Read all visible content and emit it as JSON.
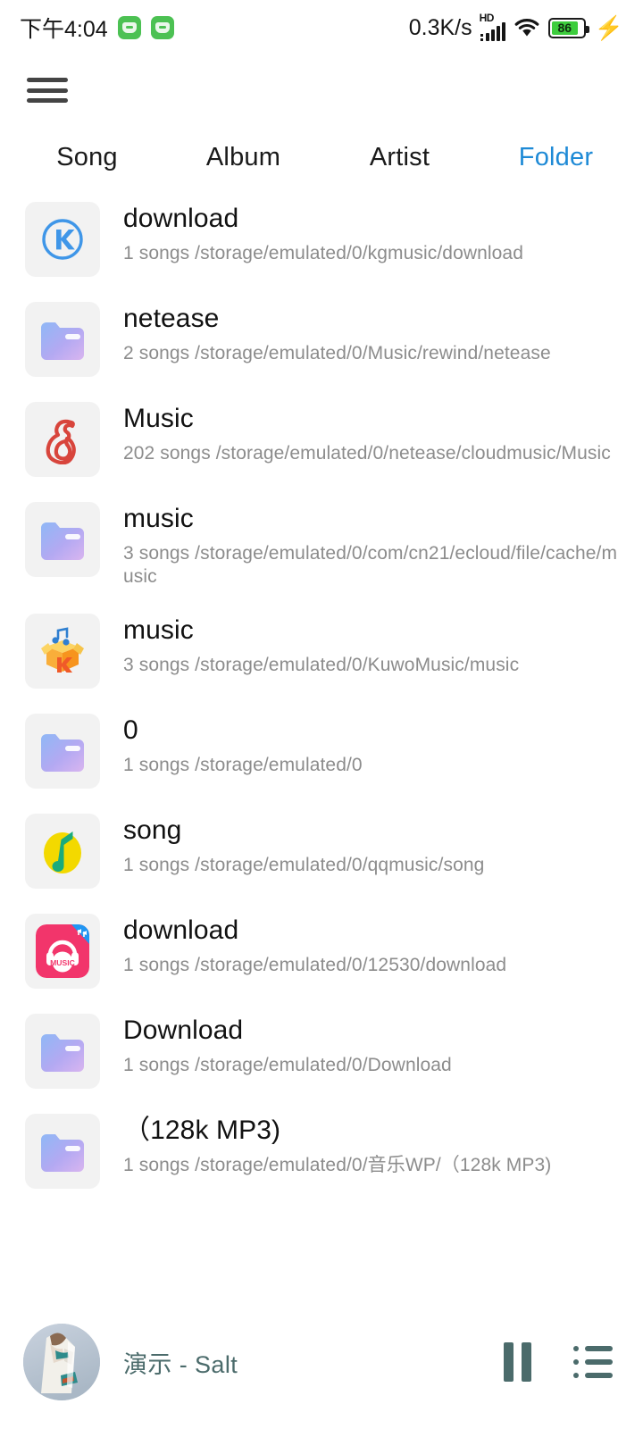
{
  "statusbar": {
    "time": "下午4:04",
    "network_speed": "0.3K/s",
    "hd_label": "HD",
    "battery_percent": "86",
    "icons": [
      "app-notification-icon",
      "app-notification-icon",
      "hd-icon",
      "signal-icon",
      "wifi-icon",
      "battery-icon",
      "charging-bolt-icon"
    ]
  },
  "topbar": {
    "menu_icon": "hamburger-menu-icon"
  },
  "tabs": [
    {
      "label": "Song",
      "active": false
    },
    {
      "label": "Album",
      "active": false
    },
    {
      "label": "Artist",
      "active": false
    },
    {
      "label": "Folder",
      "active": true
    }
  ],
  "accent_color": "#1e8ad6",
  "folders": [
    {
      "title": "download",
      "subtitle": "1 songs /storage/emulated/0/kgmusic/download",
      "icon": "kugou-icon"
    },
    {
      "title": "netease",
      "subtitle": "2 songs /storage/emulated/0/Music/rewind/netease",
      "icon": "folder-icon"
    },
    {
      "title": "Music",
      "subtitle": "202 songs /storage/emulated/0/netease/cloudmusic/Music",
      "icon": "netease-icon"
    },
    {
      "title": "music",
      "subtitle": "3 songs /storage/emulated/0/com/cn21/ecloud/file/cache/music",
      "icon": "folder-icon"
    },
    {
      "title": "music",
      "subtitle": "3 songs /storage/emulated/0/KuwoMusic/music",
      "icon": "kuwo-icon"
    },
    {
      "title": "0",
      "subtitle": "1 songs /storage/emulated/0",
      "icon": "folder-icon"
    },
    {
      "title": "song",
      "subtitle": "1 songs /storage/emulated/0/qqmusic/song",
      "icon": "qqmusic-icon"
    },
    {
      "title": "download",
      "subtitle": "1 songs /storage/emulated/0/12530/download",
      "icon": "12530-icon"
    },
    {
      "title": "Download",
      "subtitle": "1 songs /storage/emulated/0/Download",
      "icon": "folder-icon"
    },
    {
      "title": "（128k MP3)",
      "subtitle": "1 songs /storage/emulated/0/音乐WP/（128k MP3)",
      "icon": "folder-icon"
    }
  ],
  "player": {
    "track": "演示 - Salt",
    "album_art": "album-art-thumbnail",
    "pause_icon": "pause-icon",
    "playlist_icon": "playlist-icon",
    "text_color": "#4b6b6b"
  }
}
